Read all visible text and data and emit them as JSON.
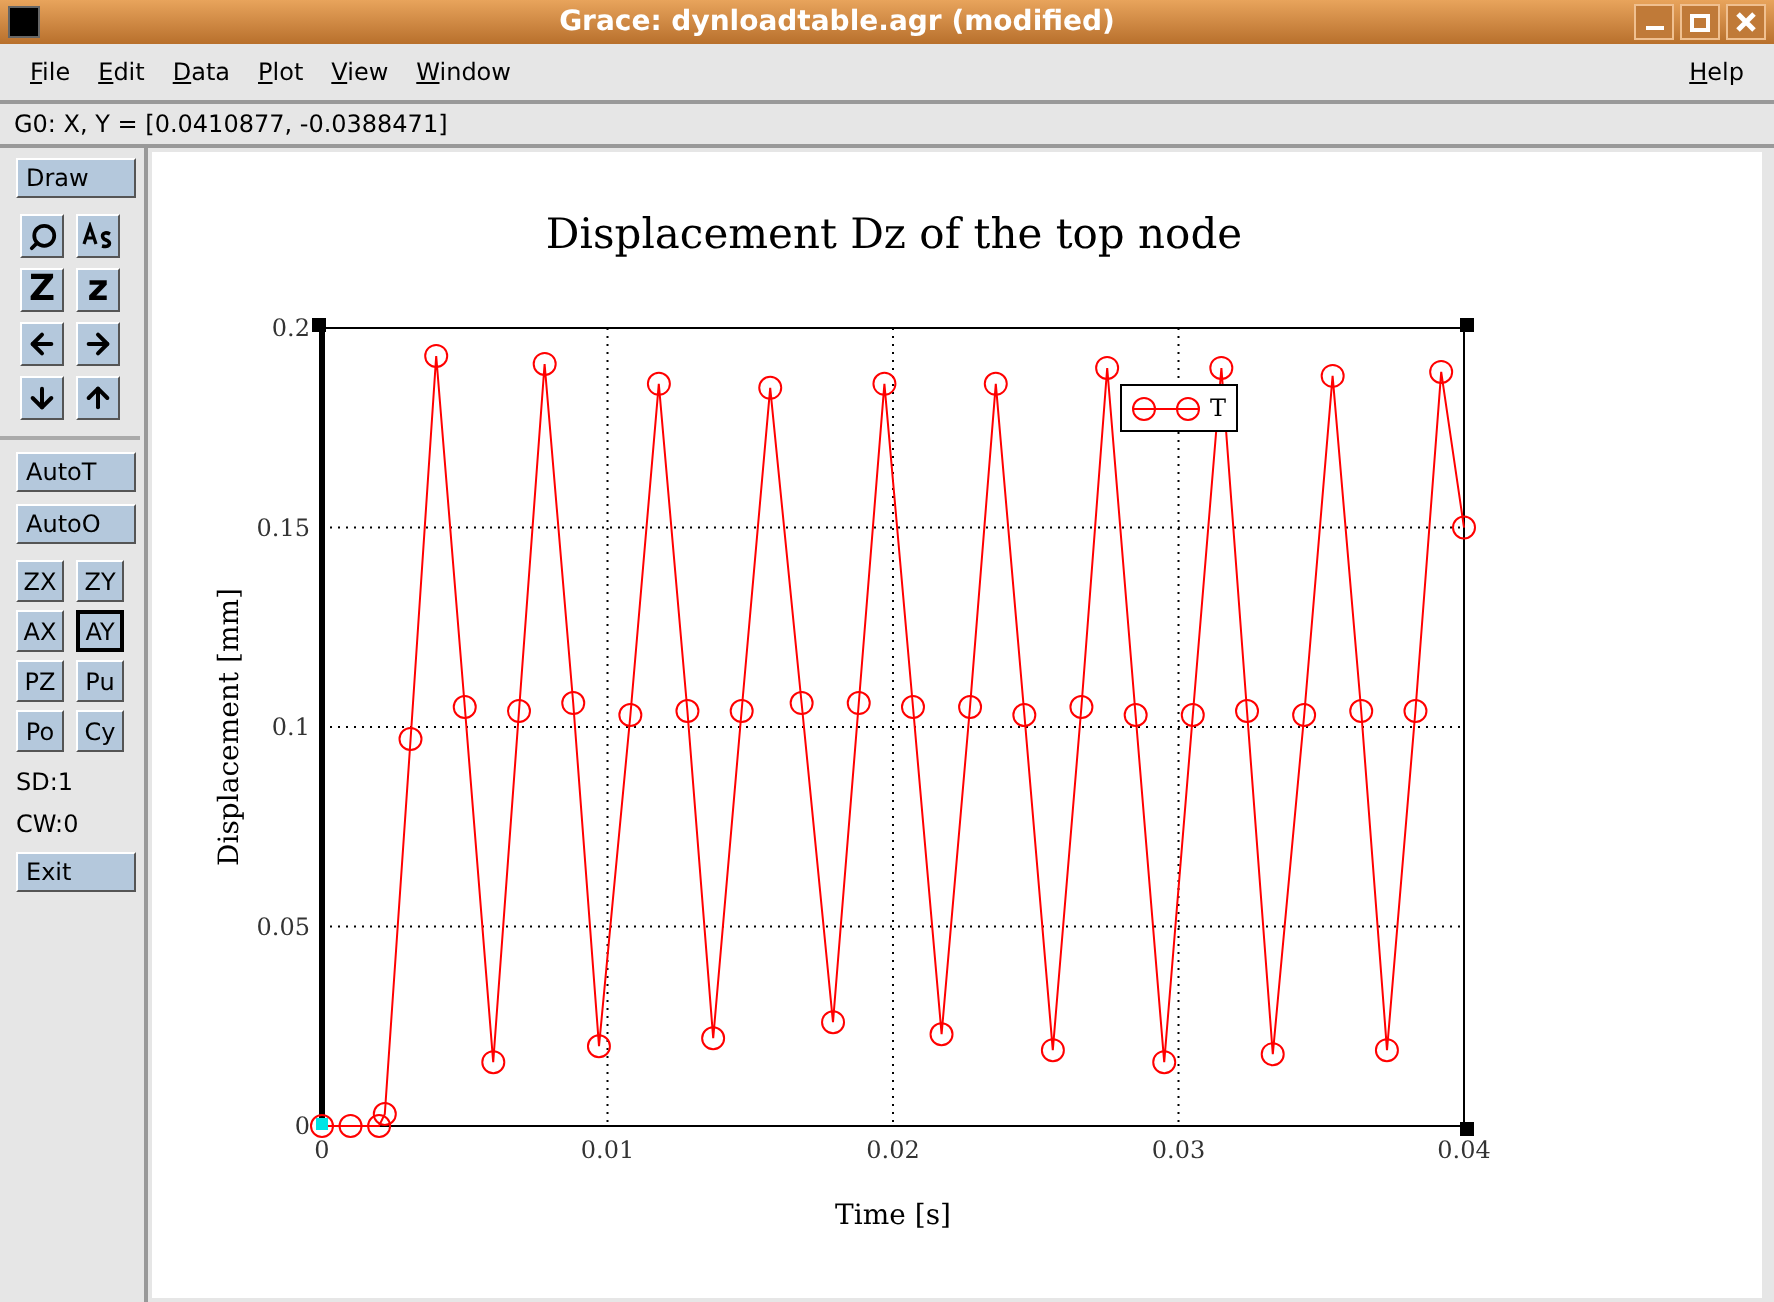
{
  "window": {
    "title": "Grace: dynloadtable.agr (modified)"
  },
  "menu": [
    {
      "label": "File"
    },
    {
      "label": "Edit"
    },
    {
      "label": "Data"
    },
    {
      "label": "Plot"
    },
    {
      "label": "View"
    },
    {
      "label": "Window"
    }
  ],
  "help_menu": {
    "label": "Help"
  },
  "locator": "G0: X, Y = [0.0410877, -0.0388471]",
  "toolbar": {
    "draw": "Draw",
    "tools": [
      {
        "kind": "magnifier"
      },
      {
        "kind": "autoscale"
      },
      {
        "kind": "text",
        "label": "Z"
      },
      {
        "kind": "text",
        "label": "z"
      },
      {
        "kind": "left"
      },
      {
        "kind": "right"
      },
      {
        "kind": "down"
      },
      {
        "kind": "up"
      }
    ],
    "auto_buttons": [
      "AutoT",
      "AutoO"
    ],
    "axis_buttons": [
      {
        "label": "ZX",
        "selected": false
      },
      {
        "label": "ZY",
        "selected": false
      },
      {
        "label": "AX",
        "selected": false
      },
      {
        "label": "AY",
        "selected": true
      },
      {
        "label": "PZ",
        "selected": false
      },
      {
        "label": "Pu",
        "selected": false
      },
      {
        "label": "Po",
        "selected": false
      },
      {
        "label": "Cy",
        "selected": false
      }
    ],
    "info": [
      "SD:1",
      "CW:0"
    ],
    "exit": "Exit"
  },
  "plot": {
    "chart_data": {
      "type": "line",
      "title": "Displacement Dz of the top node",
      "xlabel": "Time [s]",
      "ylabel": "Displacement [mm]",
      "x": [
        0,
        0.001,
        0.002,
        0.0022,
        0.0031,
        0.004,
        0.005,
        0.006,
        0.0069,
        0.0078,
        0.0088,
        0.0097,
        0.0108,
        0.0118,
        0.0128,
        0.0137,
        0.0147,
        0.0157,
        0.0168,
        0.0179,
        0.0188,
        0.0197,
        0.0207,
        0.0217,
        0.0227,
        0.0236,
        0.0246,
        0.0256,
        0.0266,
        0.0275,
        0.0285,
        0.0295,
        0.0305,
        0.0315,
        0.0324,
        0.0333,
        0.0344,
        0.0354,
        0.0364,
        0.0373,
        0.0383,
        0.0392,
        0.04
      ],
      "grid": true,
      "series": [
        {
          "name": "T",
          "color": "#ff0000",
          "marker": "circle",
          "values": [
            0,
            0,
            0,
            0.003,
            0.097,
            0.193,
            0.105,
            0.016,
            0.104,
            0.191,
            0.106,
            0.02,
            0.103,
            0.186,
            0.104,
            0.022,
            0.104,
            0.185,
            0.106,
            0.026,
            0.106,
            0.186,
            0.105,
            0.023,
            0.105,
            0.186,
            0.103,
            0.019,
            0.105,
            0.19,
            0.103,
            0.016,
            0.103,
            0.19,
            0.104,
            0.018,
            0.103,
            0.188,
            0.104,
            0.019,
            0.104,
            0.189,
            0.15
          ]
        }
      ],
      "xlim": [
        0,
        0.04
      ],
      "ylim": [
        0,
        0.2
      ],
      "xticks": [
        {
          "value": 0,
          "label": "0"
        },
        {
          "value": 0.01,
          "label": "0.01"
        },
        {
          "value": 0.02,
          "label": "0.02"
        },
        {
          "value": 0.03,
          "label": "0.03"
        },
        {
          "value": 0.04,
          "label": "0.04"
        }
      ],
      "yticks": [
        {
          "value": 0,
          "label": "0"
        },
        {
          "value": 0.05,
          "label": "0.05"
        },
        {
          "value": 0.1,
          "label": "0.1"
        },
        {
          "value": 0.15,
          "label": "0.15"
        },
        {
          "value": 0.2,
          "label": "0.2"
        }
      ]
    }
  }
}
